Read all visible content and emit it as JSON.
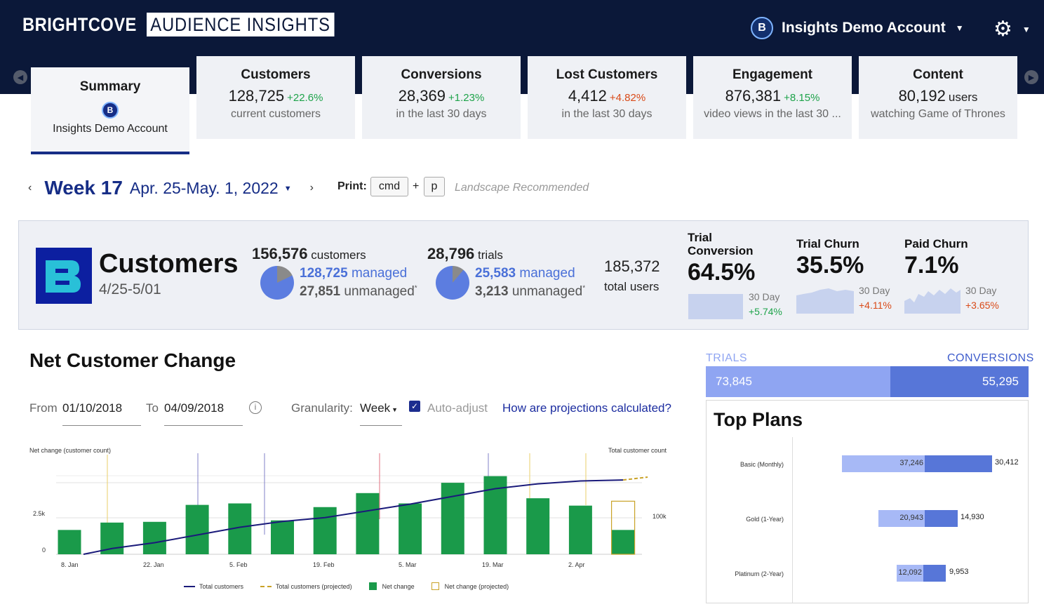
{
  "header": {
    "brand_main": "BRIGHTCOVE",
    "brand_product": "AUDIENCE INSIGHTS",
    "account_name": "Insights Demo Account",
    "account_icon_letter": "B"
  },
  "tabs": {
    "summary": {
      "title": "Summary",
      "subtitle": "Insights Demo Account"
    },
    "items": [
      {
        "title": "Customers",
        "value": "128,725",
        "change": "+22.6%",
        "change_dir": "up",
        "sub": "current customers"
      },
      {
        "title": "Conversions",
        "value": "28,369",
        "change": "+1.23%",
        "change_dir": "up",
        "sub": "in the last 30 days"
      },
      {
        "title": "Lost Customers",
        "value": "4,412",
        "change": "+4.82%",
        "change_dir": "down",
        "sub": "in the last 30 days"
      },
      {
        "title": "Engagement",
        "value": "876,381",
        "change": "+8.15%",
        "change_dir": "up",
        "sub": "video views in the last 30 ..."
      },
      {
        "title": "Content",
        "value": "80,192",
        "change": "users",
        "change_dir": "none",
        "sub": "watching Game of Thrones"
      }
    ]
  },
  "week": {
    "title": "Week 17",
    "range": "Apr. 25-May. 1, 2022",
    "prev_icon": "chevron-left-icon",
    "next_icon": "chevron-right-icon"
  },
  "print": {
    "label": "Print:",
    "key1": "cmd",
    "plus": "+",
    "key2": "p",
    "hint": "Landscape Recommended"
  },
  "customers_panel": {
    "title": "Customers",
    "dates": "4/25-5/01",
    "customers_count": "156,576",
    "customers_word": "customers",
    "customers_managed": "128,725",
    "customers_unmanaged": "27,851",
    "customers_managed_fraction": 0.822,
    "trials_count": "28,796",
    "trials_word": "trials",
    "trials_managed": "25,583",
    "trials_unmanaged": "3,213",
    "trials_managed_fraction": 0.888,
    "managed_word": "managed",
    "unmanaged_word": "unmanaged",
    "asterisk": "*",
    "total_users": "185,372",
    "total_users_label": "total users",
    "kpis": [
      {
        "title": "Trial Conversion",
        "value": "64.5%",
        "period": "30 Day",
        "change": "+5.74%",
        "change_dir": "up"
      },
      {
        "title": "Trial Churn",
        "value": "35.5%",
        "period": "30 Day",
        "change": "+4.11%",
        "change_dir": "down"
      },
      {
        "title": "Paid Churn",
        "value": "7.1%",
        "period": "30 Day",
        "change": "+3.65%",
        "change_dir": "down"
      }
    ]
  },
  "net_change": {
    "title": "Net Customer Change",
    "from_label": "From",
    "from_value": "01/10/2018",
    "to_label": "To",
    "to_value": "04/09/2018",
    "granularity_label": "Granularity:",
    "granularity_value": "Week",
    "auto_adjust_label": "Auto-adjust",
    "auto_adjust_checked": true,
    "projection_link": "How are projections calculated?"
  },
  "chart_data": {
    "type": "bar",
    "ylabel_left": "Net change (customer count)",
    "ylabel_right": "Total customer count",
    "left_ticks": [
      "0",
      "2.5k"
    ],
    "right_ticks": [
      "100k"
    ],
    "x_ticks": [
      "8. Jan",
      "22. Jan",
      "5. Feb",
      "19. Feb",
      "5. Mar",
      "19. Mar",
      "2. Apr"
    ],
    "ylim": [
      0,
      5000
    ],
    "series": [
      {
        "name": "Net change",
        "values": [
          1650,
          2150,
          2200,
          3350,
          3450,
          2300,
          3200,
          4150,
          3450,
          4850,
          5300,
          3800,
          3300,
          1650
        ],
        "color": "#1a9a4a"
      },
      {
        "name": "Net change (projected)",
        "values": [
          null,
          null,
          null,
          null,
          null,
          null,
          null,
          null,
          null,
          null,
          null,
          null,
          null,
          3600
        ],
        "color": "#c9a227"
      },
      {
        "name": "Total customers",
        "values": [
          0,
          6,
          12,
          20,
          28,
          34,
          38,
          45,
          52,
          60,
          68,
          73,
          76,
          77
        ],
        "color": "#1a1a7a"
      },
      {
        "name": "Total customers (projected)",
        "values": [
          null,
          null,
          null,
          null,
          null,
          null,
          null,
          null,
          null,
          null,
          null,
          null,
          null,
          77,
          80
        ],
        "color": "#c9a227"
      }
    ],
    "legend": [
      "Total customers",
      "Total customers (projected)",
      "Net change",
      "Net change (projected)"
    ]
  },
  "trials_conversions": {
    "trials_label": "TRIALS",
    "conversions_label": "CONVERSIONS",
    "trials_value": "73,845",
    "conversions_value": "55,295"
  },
  "top_plans": {
    "title": "Top Plans",
    "plans": [
      {
        "name": "Basic (Monthly)",
        "trials": "37,246",
        "conversions": "30,412"
      },
      {
        "name": "Gold (1-Year)",
        "trials": "20,943",
        "conversions": "14,930"
      },
      {
        "name": "Platinum (2-Year)",
        "trials": "12,092",
        "conversions": "9,953"
      }
    ]
  },
  "colors": {
    "navy": "#0b1839",
    "accent": "#162d86",
    "green": "#1a9a4a",
    "red": "#d94a18",
    "light_blue": "#a7b9f6",
    "mid_blue": "#5776d8"
  }
}
